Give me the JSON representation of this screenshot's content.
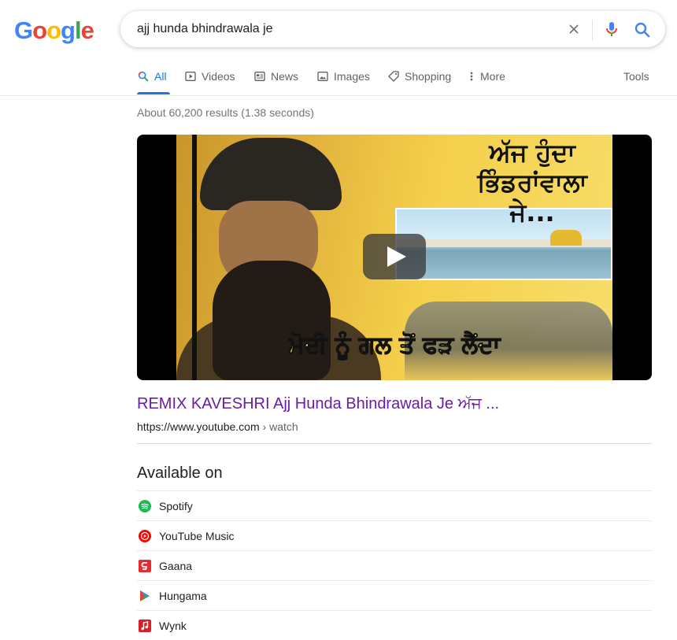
{
  "logo": {
    "letters": [
      "G",
      "o",
      "o",
      "g",
      "l",
      "e"
    ]
  },
  "search": {
    "query": "ajj hunda bhindrawala je"
  },
  "tabs": [
    {
      "label": "All",
      "icon": "search-icon",
      "active": true
    },
    {
      "label": "Videos",
      "icon": "play-box-icon"
    },
    {
      "label": "News",
      "icon": "newspaper-icon"
    },
    {
      "label": "Images",
      "icon": "image-icon"
    },
    {
      "label": "Shopping",
      "icon": "tag-icon"
    },
    {
      "label": "More",
      "icon": "more-vert-icon"
    }
  ],
  "tools_label": "Tools",
  "stats": "About 60,200 results (1.38 seconds)",
  "video": {
    "poster_title": "ਅੱਜ ਹੁੰਦਾ ਭਿੰਡਰਾਂਵਾਲਾ ਜੇ...",
    "poster_caption": "ਮੋਦੀ ਨੂੰ ਗਲ ਤੋਂ ਫੜ ਲੈਂਦਾ"
  },
  "result": {
    "title": "REMIX KAVESHRI Ajj Hunda Bhindrawala Je ਅੱਜ ...",
    "url": "https://www.youtube.com",
    "crumb": " › watch"
  },
  "available_on": {
    "heading": "Available on",
    "providers": [
      {
        "name": "Spotify",
        "icon": "spotify-icon",
        "color": "#1db954"
      },
      {
        "name": "YouTube Music",
        "icon": "youtube-music-icon",
        "color": "#ff0000"
      },
      {
        "name": "Gaana",
        "icon": "gaana-icon",
        "color": "#e72c30"
      },
      {
        "name": "Hungama",
        "icon": "hungama-icon",
        "color": "#f4b400"
      },
      {
        "name": "Wynk",
        "icon": "wynk-icon",
        "color": "#d71f2a"
      }
    ]
  }
}
